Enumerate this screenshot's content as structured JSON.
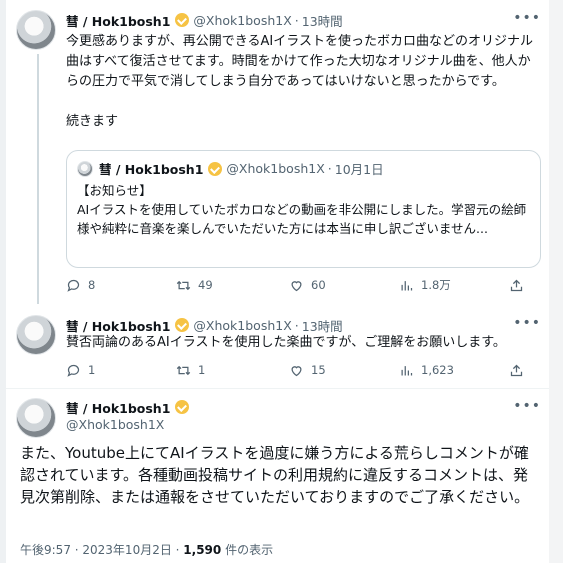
{
  "tweet1": {
    "name": "彗 / Hok1bosh1",
    "handle": "@Xhok1bosh1X",
    "time": "13時間",
    "text": "今更感ありますが、再公開できるAIイラストを使ったボカロ曲などのオリジナル曲はすべて復活させてます。時間をかけて作った大切なオリジナル曲を、他人からの圧力で平気で消してしまう自分であってはいけないと思ったからです。\n\n続きます",
    "quote": {
      "name": "彗 / Hok1bosh1",
      "handle": "@Xhok1bosh1X",
      "date": "10月1日",
      "text": "【お知らせ】\nAIイラストを使用していたボカロなどの動画を非公開にしました。学習元の絵師様や純粋に音楽を楽しんでいただいた方には本当に申し訳ございません..."
    },
    "replies": "8",
    "retweets": "49",
    "likes": "60",
    "views": "1.8万"
  },
  "tweet2": {
    "name": "彗 / Hok1bosh1",
    "handle": "@Xhok1bosh1X",
    "time": "13時間",
    "text": "賛否両論のあるAIイラストを使用した楽曲ですが、ご理解をお願いします。",
    "replies": "1",
    "retweets": "1",
    "likes": "15",
    "views": "1,623"
  },
  "tweet3": {
    "name": "彗 / Hok1bosh1",
    "handle": "@Xhok1bosh1X",
    "text": "また、Youtube上にてAIイラストを過度に嫌う方による荒らしコメントが確認されています。各種動画投稿サイトの利用規約に違反するコメントは、発見次第削除、または通報をさせていただいておりますのでご了承ください。",
    "timestamp": "午後9:57 · 2023年10月2日 · ",
    "views_count": "1,590",
    "views_label": " 件の表示"
  },
  "icons": [
    "reply-icon",
    "retweet-icon",
    "like-icon",
    "views-icon",
    "share-icon",
    "more-icon",
    "verified-icon"
  ],
  "colors": {
    "text": "#0f1419",
    "muted": "#536471",
    "border": "#cfd9de",
    "verified": "#f6c344"
  }
}
